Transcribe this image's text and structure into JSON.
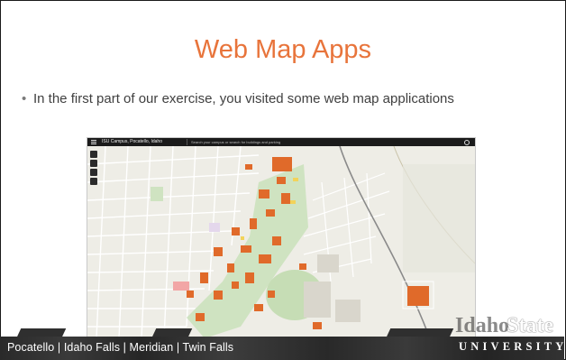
{
  "slide": {
    "title": "Web Map Apps",
    "bullet": "In the first part of our exercise, you visited some web map applications"
  },
  "map_app": {
    "title": "ISU Campus, Pocatello, Idaho",
    "search_placeholder": "Search your campus or search for buildings and parking"
  },
  "footer": {
    "locations": "Pocatello  |  Idaho Falls  |  Meridian  |  Twin Falls",
    "logo_line1_a": "Idaho",
    "logo_line1_b": "State",
    "logo_line2": "UNIVERSITY"
  },
  "colors": {
    "title": "#e8743b",
    "building": "#e06a2a",
    "footer_bg": "#2e2e2e"
  }
}
